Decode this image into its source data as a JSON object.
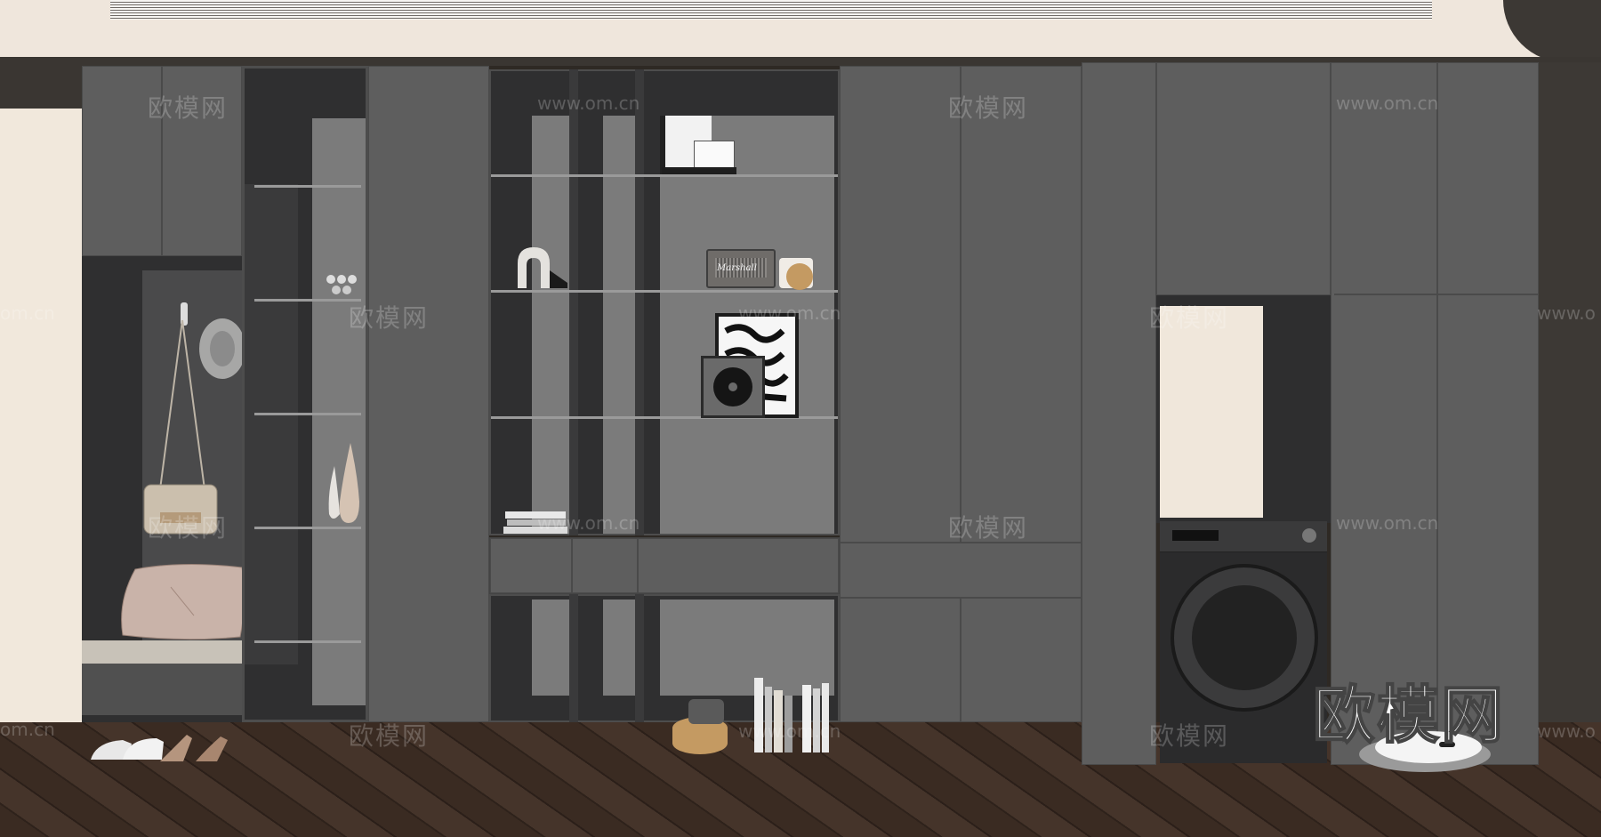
{
  "image": {
    "subject": "dark grey built-in wardrobe and entryway cabinet wall",
    "colors": {
      "cabinet": "#5b5b5b",
      "cabinet_dark": "#2f2f30",
      "shelf_back": "#7b7b7b",
      "wall_cream": "#f1e8dc",
      "floor": "#3a2b22",
      "ceiling": "#efe6dc"
    }
  },
  "watermarks": {
    "cn": "欧模网",
    "url": "www.om.cn",
    "url_short": "om.cn",
    "url_dot": "www.o",
    "logo": "欧模网"
  },
  "objects": {
    "speaker_brand": "Marshall"
  }
}
